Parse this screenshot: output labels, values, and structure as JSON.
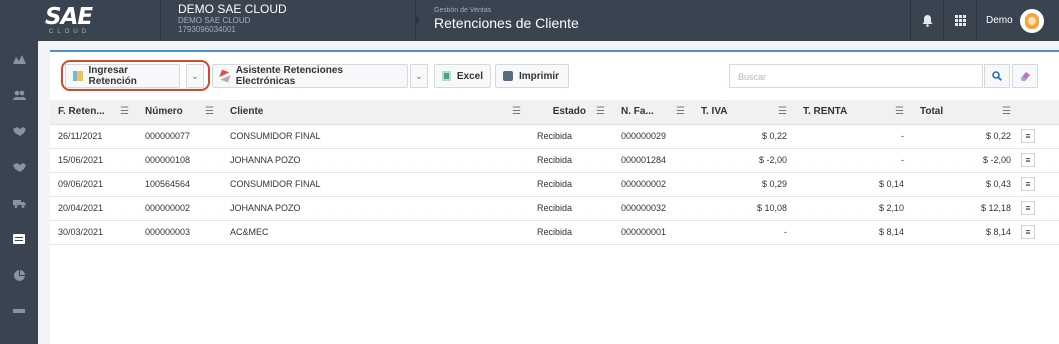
{
  "logo": {
    "main": "SAE",
    "sub": "CLOUD"
  },
  "company": {
    "name": "DEMO SAE CLOUD",
    "line2": "DEMO SAE CLOUD",
    "ruc": "1793096034001"
  },
  "module": {
    "category": "Gestión de Ventas",
    "title": "Retenciones de Cliente"
  },
  "topbar_icons": [
    "bell-icon",
    "apps-grid-icon"
  ],
  "user": {
    "name": "Demo"
  },
  "sidebar": [
    "inventory-icon",
    "users-icon",
    "handshake-icon",
    "handshake-2-icon",
    "truck-icon",
    "documents-icon",
    "pie-chart-icon",
    "more-icon"
  ],
  "toolbar": {
    "ingresar": "Ingresar Retención",
    "asistente": "Asistente Retenciones Electrónicas",
    "excel": "Excel",
    "imprimir": "Imprimir",
    "search_placeholder": "Buscar"
  },
  "accent": "#4a90d9",
  "highlight_color": "#d9452f",
  "table": {
    "headers": [
      "F. Reten...",
      "Número",
      "Cliente",
      "Estado",
      "N. Fa...",
      "T. IVA",
      "T. RENTA",
      "Total"
    ],
    "rows": [
      [
        "26/11/2021",
        "000000077",
        "CONSUMIDOR FINAL",
        "Recibida",
        "000000029",
        "$ 0,22",
        "-",
        "$ 0,22"
      ],
      [
        "15/06/2021",
        "000000108",
        "JOHANNA POZO",
        "Recibida",
        "000001284",
        "$ -2,00",
        "-",
        "$ -2,00"
      ],
      [
        "09/06/2021",
        "100564564",
        "CONSUMIDOR FINAL",
        "Recibida",
        "000000002",
        "$ 0,29",
        "$ 0,14",
        "$ 0,43"
      ],
      [
        "20/04/2021",
        "000000002",
        "JOHANNA POZO",
        "Recibida",
        "000000032",
        "$ 10,08",
        "$ 2,10",
        "$ 12,18"
      ],
      [
        "30/03/2021",
        "000000003",
        "AC&MEC",
        "Recibida",
        "000000001",
        "-",
        "$ 8,14",
        "$ 8,14"
      ]
    ]
  }
}
